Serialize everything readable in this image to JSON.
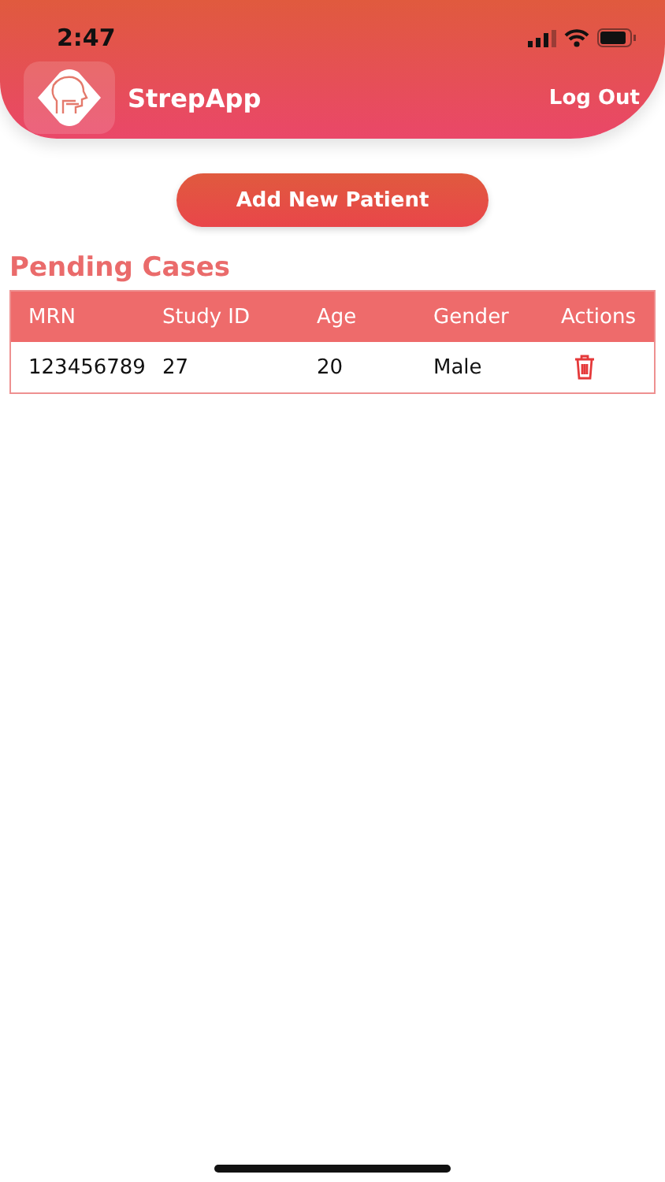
{
  "status_bar": {
    "time": "2:47"
  },
  "header": {
    "app_name": "StrepApp",
    "logout": "Log Out"
  },
  "add_button": "Add New Patient",
  "section_title": "Pending Cases",
  "table": {
    "columns": [
      "MRN",
      "Study ID",
      "Age",
      "Gender",
      "Actions"
    ],
    "rows": [
      {
        "cells": [
          "123456789",
          "27",
          "20",
          "Male"
        ]
      }
    ]
  }
}
